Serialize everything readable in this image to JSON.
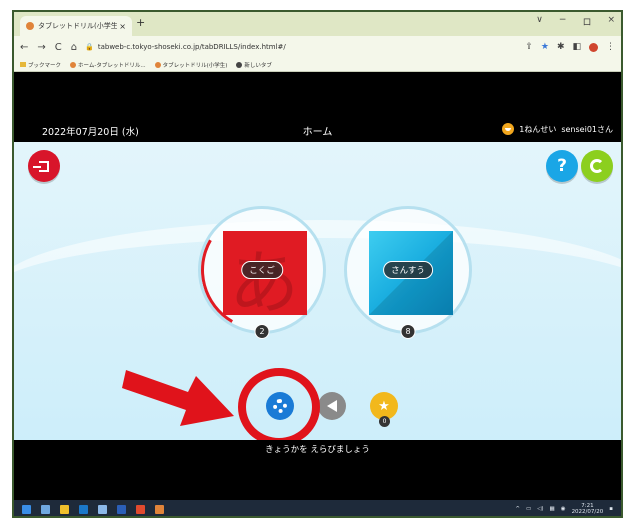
{
  "browser": {
    "tab_title": "タブレットドリル(小学生)",
    "tab_close": "×",
    "new_tab": "+",
    "window_controls": [
      "∨",
      "−",
      "ロ",
      "×"
    ],
    "url": "tabweb-c.tokyo-shoseki.co.jp/tabDRILLS/index.html#/",
    "bookmarks": [
      "ブックマーク",
      "ホーム-タブレットドリル...",
      "タブレットドリル(小学生)",
      "新しいタブ"
    ]
  },
  "header": {
    "date": "2022年07月20日 (水)",
    "title": "ホーム",
    "grade": "1ねんせい",
    "user": "sensei01さん"
  },
  "subjects": [
    {
      "label": "こくご",
      "count": "2",
      "glyph": "あ"
    },
    {
      "label": "さんすう",
      "count": "8"
    }
  ],
  "tools": {
    "star_badge": "0",
    "help_label": "?"
  },
  "footer": {
    "message": "きょうかを えらびましょう"
  },
  "taskbar": {
    "time": "7:21",
    "date": "2022/07/20"
  },
  "colors": {
    "exit": "#d8152a",
    "help": "#1aa6e6",
    "refresh": "#8ccf1e",
    "kokugo": "#e01b23",
    "sansu": "#1ab0e2",
    "highlight": "#e0131b"
  }
}
